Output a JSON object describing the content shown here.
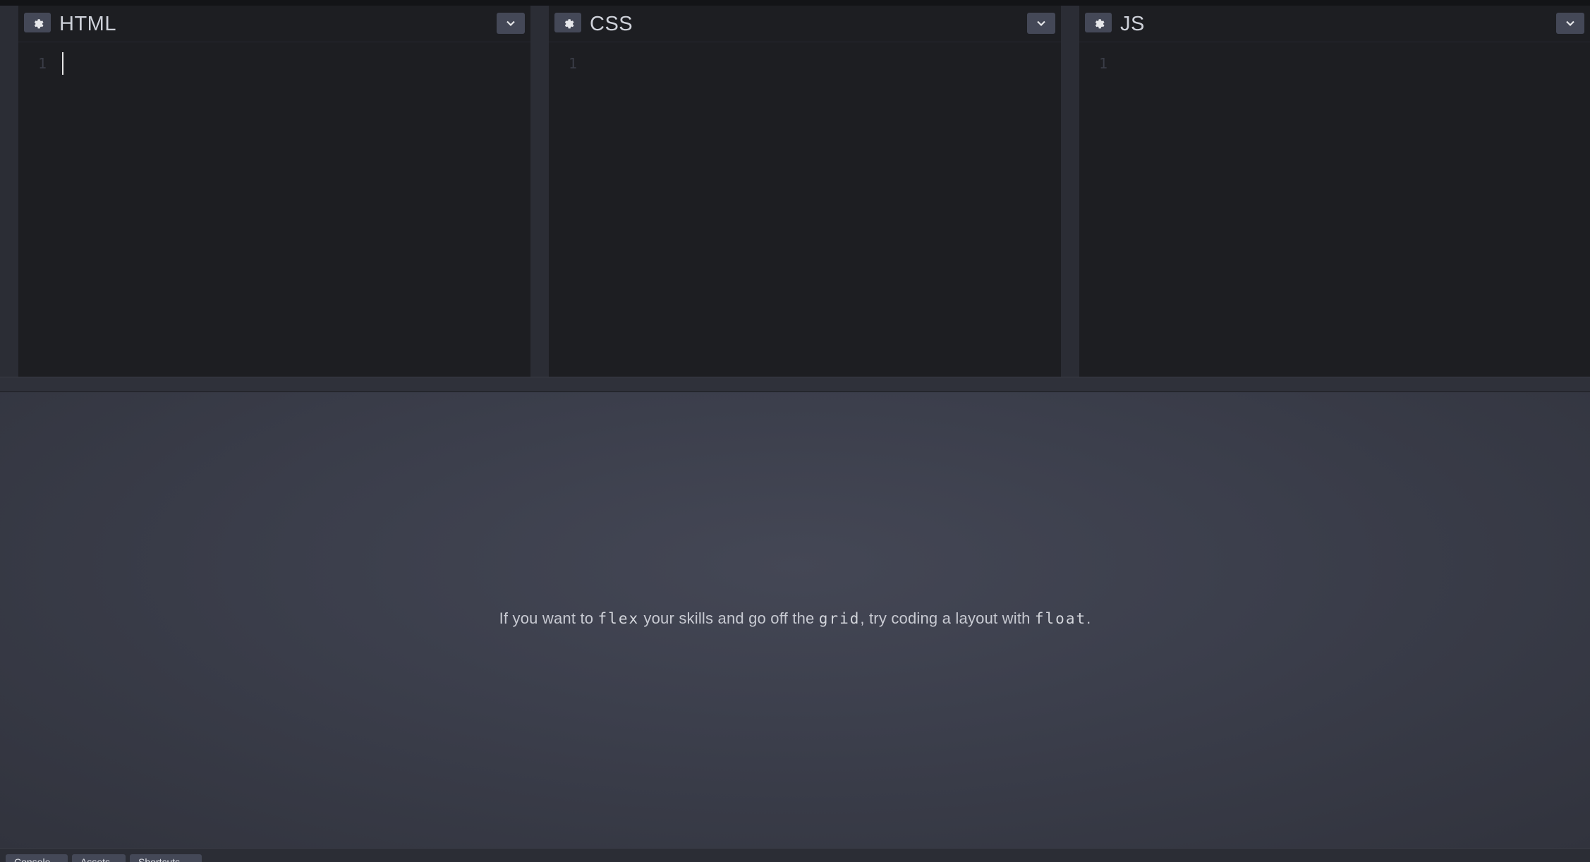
{
  "editors": [
    {
      "title": "HTML",
      "line_number": "1"
    },
    {
      "title": "CSS",
      "line_number": "1"
    },
    {
      "title": "JS",
      "line_number": "1"
    }
  ],
  "icons": {
    "settings": "gear-icon",
    "collapse": "chevron-down-icon"
  },
  "preview": {
    "text_1": "If you want to ",
    "code_1": "flex",
    "text_2": " your skills and go off the ",
    "code_2": "grid",
    "text_3": ", try coding a layout with ",
    "code_3": "float",
    "text_4": "."
  },
  "bottom_tabs": [
    {
      "label": "Console"
    },
    {
      "label": "Assets"
    },
    {
      "label": "Shortcuts"
    }
  ],
  "colors": {
    "editor_bg": "#1d1e22",
    "button_bg": "#444857",
    "preview_bg": "#3b3e4b"
  }
}
